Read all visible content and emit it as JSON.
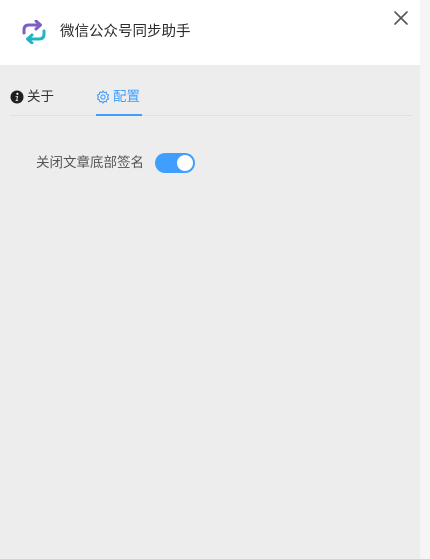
{
  "app": {
    "title": "微信公众号同步助手"
  },
  "tabs": [
    {
      "label": "关于",
      "icon": "info-icon",
      "active": false
    },
    {
      "label": "配置",
      "icon": "gear-icon",
      "active": true
    }
  ],
  "settings": {
    "close_footer_signature": {
      "label": "关闭文章底部签名",
      "enabled": true
    }
  },
  "colors": {
    "accent": "#409eff",
    "logo_purple": "#7b5fc7",
    "logo_teal": "#23b3c7"
  }
}
